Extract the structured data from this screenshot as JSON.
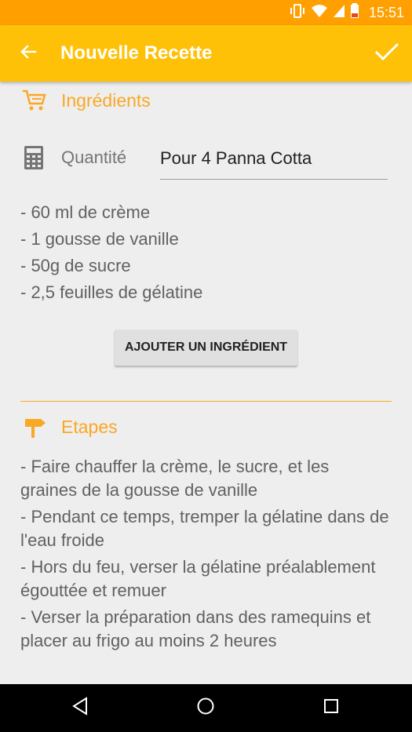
{
  "status_bar": {
    "time": "15:51"
  },
  "app_bar": {
    "title": "Nouvelle Recette"
  },
  "ingredients_section": {
    "title": "Ingrédients",
    "quantity_label": "Quantité",
    "quantity_value": "Pour 4 Panna Cotta",
    "items": [
      "- 60 ml de crème",
      "- 1 gousse de vanille",
      "- 50g de sucre",
      "- 2,5 feuilles de gélatine"
    ],
    "add_button_label": "AJOUTER UN INGRÉDIENT"
  },
  "steps_section": {
    "title": "Etapes",
    "items": [
      "- Faire chauffer la crème, le sucre, et les graines de la gousse de vanille",
      "- Pendant ce temps, tremper la gélatine dans de l'eau froide",
      "- Hors du feu, verser la gélatine préalablement égouttée et remuer",
      "- Verser la préparation dans des ramequins et placer au frigo au moins 2 heures"
    ]
  },
  "colors": {
    "status_bar": "#FFA000",
    "app_bar": "#FFC107",
    "accent": "#F9A825"
  },
  "icons": {
    "back": "arrow-back-icon",
    "confirm": "check-icon",
    "ingredients": "cart-icon",
    "quantity": "calculator-icon",
    "steps": "signpost-icon"
  }
}
